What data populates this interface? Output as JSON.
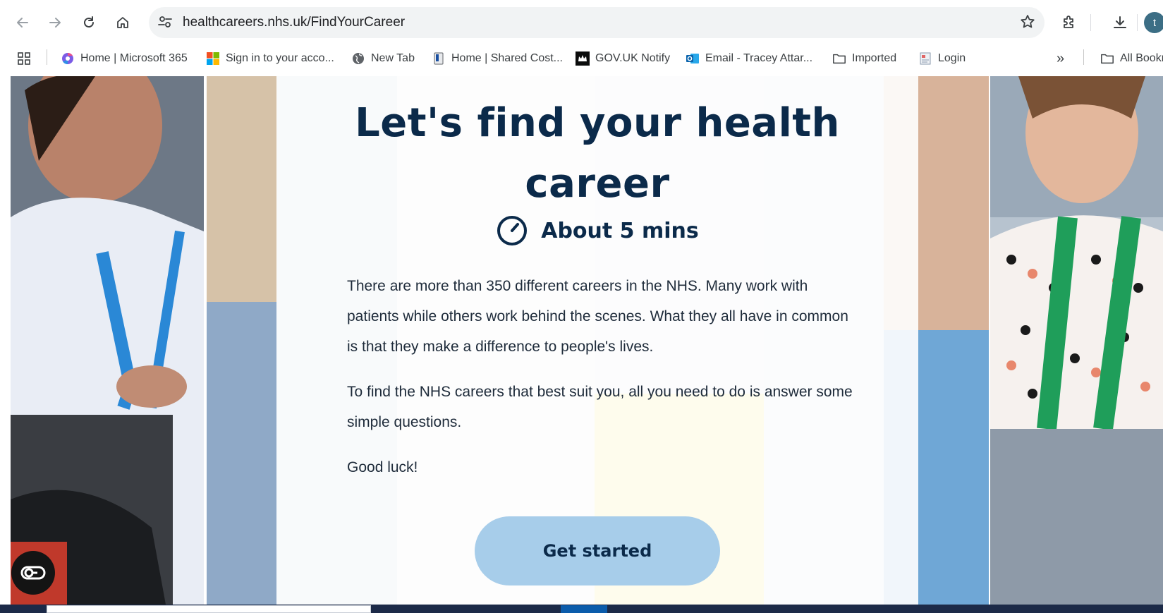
{
  "browser": {
    "url": "healthcareers.nhs.uk/FindYourCareer",
    "profile_initial": "t",
    "bookmarks": [
      {
        "label": "Home | Microsoft 365",
        "icon": "microsoft365-icon"
      },
      {
        "label": "Sign in to your acco...",
        "icon": "microsoft-icon"
      },
      {
        "label": "New Tab",
        "icon": "globe-icon"
      },
      {
        "label": "Home | Shared Cost...",
        "icon": "page-icon"
      },
      {
        "label": "GOV.UK Notify",
        "icon": "crown-icon"
      },
      {
        "label": "Email - Tracey Attar...",
        "icon": "outlook-icon"
      },
      {
        "label": "Imported",
        "icon": "folder-icon"
      },
      {
        "label": "Login",
        "icon": "document-icon"
      }
    ],
    "more_label": "»",
    "all_bookmarks": "All Bookmarks"
  },
  "page": {
    "heading_line1": "Let's find your health",
    "heading_line2": "career",
    "time": "About 5 mins",
    "para1": "There are more than 350 different careers in the NHS. Many work with patients while others work behind the scenes. What they all have in common is that they make a difference to people's lives.",
    "para2": "To find the NHS careers that best suit you, all you need to do is answer some simple questions.",
    "para3": "Good luck!",
    "cta": "Get started"
  },
  "colors": {
    "heading": "#0b2a4a",
    "button": "#a7cdea",
    "accessibility_button": "#141414"
  }
}
